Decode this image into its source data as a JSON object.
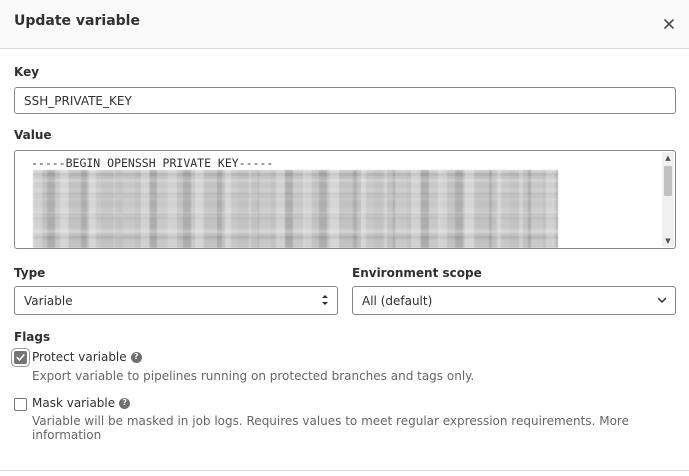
{
  "modal": {
    "title": "Update variable",
    "close_icon": "close-icon"
  },
  "key": {
    "label": "Key",
    "value": "SSH_PRIVATE_KEY"
  },
  "value_field": {
    "label": "Value",
    "first_line": "-----BEGIN OPENSSH PRIVATE KEY-----",
    "icons": {
      "scroll_up": "chevron-up-icon",
      "scroll_down": "chevron-down-icon"
    }
  },
  "type": {
    "label": "Type",
    "selected": "Variable",
    "icon": "updown-caret-icon"
  },
  "environment_scope": {
    "label": "Environment scope",
    "selected": "All (default)",
    "icon": "chevron-down-icon"
  },
  "flags": {
    "label": "Flags",
    "protect": {
      "label": "Protect variable",
      "checked": true,
      "help": "Export variable to pipelines running on protected branches and tags only.",
      "icon": "question-circle-icon"
    },
    "mask": {
      "label": "Mask variable",
      "checked": false,
      "help_line1": "Variable will be masked in job logs. Requires values to meet regular expression requirements. More",
      "help_line2": "information",
      "icon": "question-circle-icon"
    }
  },
  "colors": {
    "border": "#868686",
    "header_bg": "#fafafa",
    "checkbox_checked": "#767676",
    "help_text": "#666666"
  }
}
